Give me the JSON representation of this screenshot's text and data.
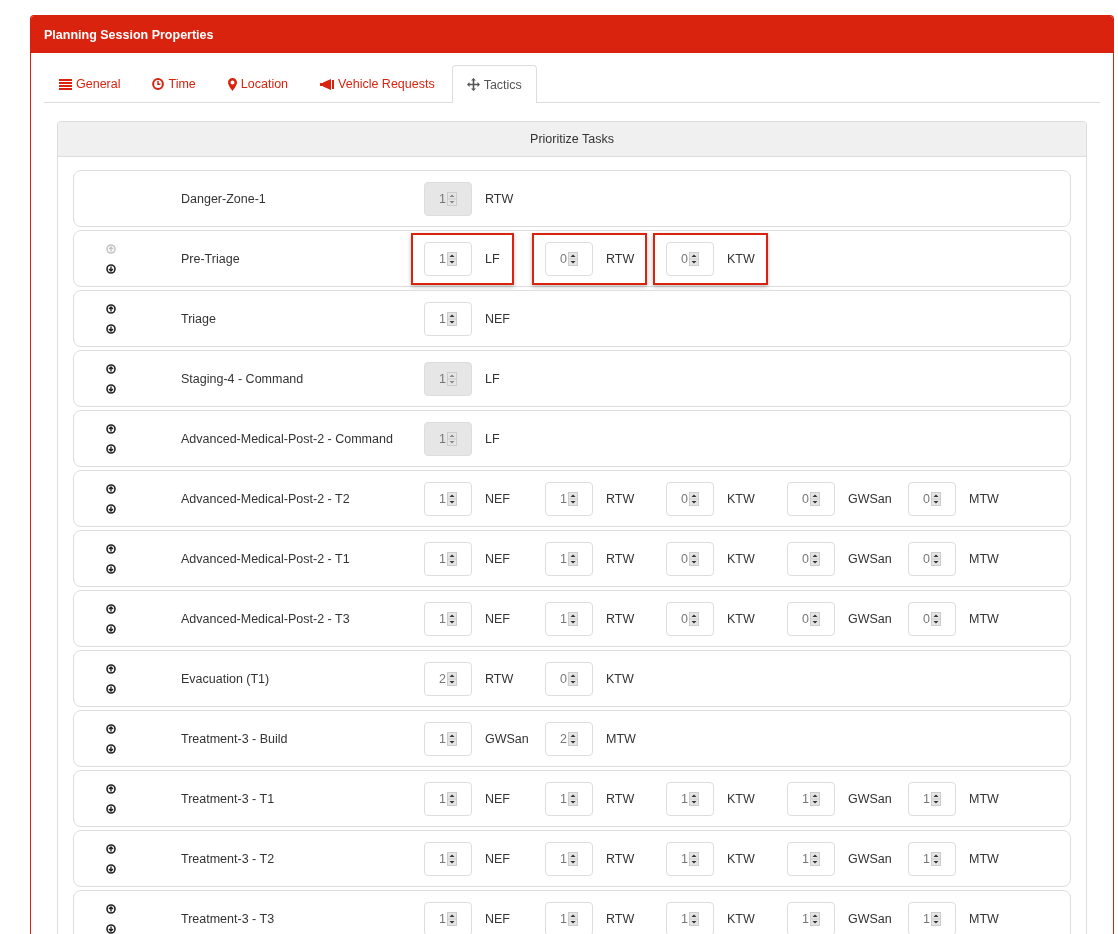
{
  "panel": {
    "title": "Planning Session Properties"
  },
  "tabs": [
    {
      "label": "General",
      "selected": false
    },
    {
      "label": "Time",
      "selected": false
    },
    {
      "label": "Location",
      "selected": false
    },
    {
      "label": "Vehicle Requests",
      "selected": false
    },
    {
      "label": "Tactics",
      "selected": true
    }
  ],
  "section": {
    "title": "Prioritize Tasks"
  },
  "tasks": [
    {
      "name": "Danger-Zone-1",
      "movable": false,
      "vehicles": [
        {
          "value": "1",
          "type": "RTW",
          "disabled": true,
          "highlighted": false
        }
      ]
    },
    {
      "name": "Pre-Triage",
      "movable": true,
      "up_disabled": true,
      "vehicles": [
        {
          "value": "1",
          "type": "LF",
          "disabled": false,
          "highlighted": true
        },
        {
          "value": "0",
          "type": "RTW",
          "disabled": false,
          "highlighted": true
        },
        {
          "value": "0",
          "type": "KTW",
          "disabled": false,
          "highlighted": true
        }
      ]
    },
    {
      "name": "Triage",
      "movable": true,
      "up_disabled": false,
      "vehicles": [
        {
          "value": "1",
          "type": "NEF",
          "disabled": false,
          "highlighted": false
        }
      ]
    },
    {
      "name": "Staging-4 - Command",
      "movable": true,
      "up_disabled": false,
      "vehicles": [
        {
          "value": "1",
          "type": "LF",
          "disabled": true,
          "highlighted": false
        }
      ]
    },
    {
      "name": "Advanced-Medical-Post-2 - Command",
      "movable": true,
      "up_disabled": false,
      "vehicles": [
        {
          "value": "1",
          "type": "LF",
          "disabled": true,
          "highlighted": false
        }
      ]
    },
    {
      "name": "Advanced-Medical-Post-2 - T2",
      "movable": true,
      "up_disabled": false,
      "vehicles": [
        {
          "value": "1",
          "type": "NEF",
          "disabled": false,
          "highlighted": false
        },
        {
          "value": "1",
          "type": "RTW",
          "disabled": false,
          "highlighted": false
        },
        {
          "value": "0",
          "type": "KTW",
          "disabled": false,
          "highlighted": false
        },
        {
          "value": "0",
          "type": "GWSan",
          "disabled": false,
          "highlighted": false
        },
        {
          "value": "0",
          "type": "MTW",
          "disabled": false,
          "highlighted": false
        }
      ]
    },
    {
      "name": "Advanced-Medical-Post-2 - T1",
      "movable": true,
      "up_disabled": false,
      "vehicles": [
        {
          "value": "1",
          "type": "NEF",
          "disabled": false,
          "highlighted": false
        },
        {
          "value": "1",
          "type": "RTW",
          "disabled": false,
          "highlighted": false
        },
        {
          "value": "0",
          "type": "KTW",
          "disabled": false,
          "highlighted": false
        },
        {
          "value": "0",
          "type": "GWSan",
          "disabled": false,
          "highlighted": false
        },
        {
          "value": "0",
          "type": "MTW",
          "disabled": false,
          "highlighted": false
        }
      ]
    },
    {
      "name": "Advanced-Medical-Post-2 - T3",
      "movable": true,
      "up_disabled": false,
      "vehicles": [
        {
          "value": "1",
          "type": "NEF",
          "disabled": false,
          "highlighted": false
        },
        {
          "value": "1",
          "type": "RTW",
          "disabled": false,
          "highlighted": false
        },
        {
          "value": "0",
          "type": "KTW",
          "disabled": false,
          "highlighted": false
        },
        {
          "value": "0",
          "type": "GWSan",
          "disabled": false,
          "highlighted": false
        },
        {
          "value": "0",
          "type": "MTW",
          "disabled": false,
          "highlighted": false
        }
      ]
    },
    {
      "name": "Evacuation (T1)",
      "movable": true,
      "up_disabled": false,
      "vehicles": [
        {
          "value": "2",
          "type": "RTW",
          "disabled": false,
          "highlighted": false
        },
        {
          "value": "0",
          "type": "KTW",
          "disabled": false,
          "highlighted": false
        }
      ]
    },
    {
      "name": "Treatment-3 - Build",
      "movable": true,
      "up_disabled": false,
      "vehicles": [
        {
          "value": "1",
          "type": "GWSan",
          "disabled": false,
          "highlighted": false
        },
        {
          "value": "2",
          "type": "MTW",
          "disabled": false,
          "highlighted": false
        }
      ]
    },
    {
      "name": "Treatment-3 - T1",
      "movable": true,
      "up_disabled": false,
      "vehicles": [
        {
          "value": "1",
          "type": "NEF",
          "disabled": false,
          "highlighted": false
        },
        {
          "value": "1",
          "type": "RTW",
          "disabled": false,
          "highlighted": false
        },
        {
          "value": "1",
          "type": "KTW",
          "disabled": false,
          "highlighted": false
        },
        {
          "value": "1",
          "type": "GWSan",
          "disabled": false,
          "highlighted": false
        },
        {
          "value": "1",
          "type": "MTW",
          "disabled": false,
          "highlighted": false
        }
      ]
    },
    {
      "name": "Treatment-3 - T2",
      "movable": true,
      "up_disabled": false,
      "vehicles": [
        {
          "value": "1",
          "type": "NEF",
          "disabled": false,
          "highlighted": false
        },
        {
          "value": "1",
          "type": "RTW",
          "disabled": false,
          "highlighted": false
        },
        {
          "value": "1",
          "type": "KTW",
          "disabled": false,
          "highlighted": false
        },
        {
          "value": "1",
          "type": "GWSan",
          "disabled": false,
          "highlighted": false
        },
        {
          "value": "1",
          "type": "MTW",
          "disabled": false,
          "highlighted": false
        }
      ]
    },
    {
      "name": "Treatment-3 - T3",
      "movable": true,
      "up_disabled": false,
      "vehicles": [
        {
          "value": "1",
          "type": "NEF",
          "disabled": false,
          "highlighted": false
        },
        {
          "value": "1",
          "type": "RTW",
          "disabled": false,
          "highlighted": false
        },
        {
          "value": "1",
          "type": "KTW",
          "disabled": false,
          "highlighted": false
        },
        {
          "value": "1",
          "type": "GWSan",
          "disabled": false,
          "highlighted": false
        },
        {
          "value": "1",
          "type": "MTW",
          "disabled": false,
          "highlighted": false
        }
      ]
    }
  ]
}
